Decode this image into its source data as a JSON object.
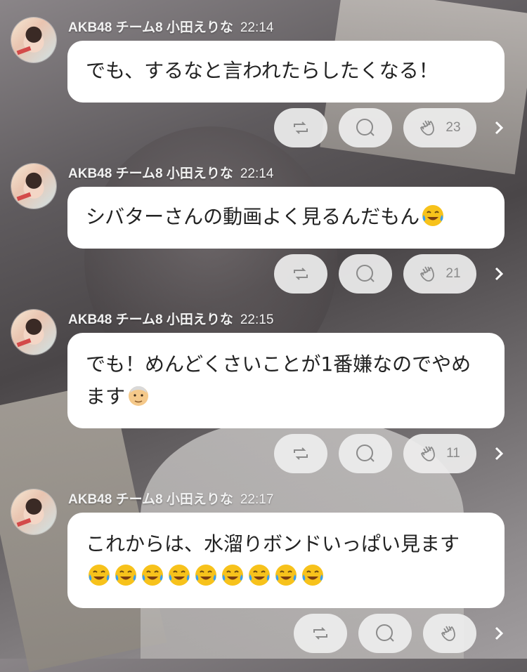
{
  "messages": [
    {
      "author": "AKB48 チーム8 小田えりな",
      "time": "22:14",
      "text": "でも、するなと言われたらしたくなる！",
      "emojis": [],
      "clap_count": "23"
    },
    {
      "author": "AKB48 チーム8 小田えりな",
      "time": "22:14",
      "text": "シバターさんの動画よく見るんだもん",
      "emojis": [
        "tears-of-joy"
      ],
      "clap_count": "21"
    },
    {
      "author": "AKB48 チーム8 小田えりな",
      "time": "22:15",
      "text": "でも！めんどくさいことが1番嫌なのでやめます",
      "emojis": [
        "older-man"
      ],
      "clap_count": "11"
    },
    {
      "author": "AKB48 チーム8 小田えりな",
      "time": "22:17",
      "text": "これからは、水溜りボンドいっぱい見ます",
      "emojis": [
        "tears-of-joy",
        "tears-of-joy",
        "tears-of-joy",
        "tears-of-joy",
        "tears-of-joy",
        "tears-of-joy",
        "tears-of-joy",
        "tears-of-joy",
        "tears-of-joy"
      ],
      "clap_count": ""
    }
  ],
  "icons": {
    "repost": "repost-icon",
    "comment": "comment-icon",
    "clap": "clap-icon",
    "more": "chevron-right-icon"
  },
  "colors": {
    "bubble": "#ffffff",
    "pill": "#eeeeee",
    "icon": "#8b8b8b",
    "meta_text": "#f2f2f2"
  }
}
